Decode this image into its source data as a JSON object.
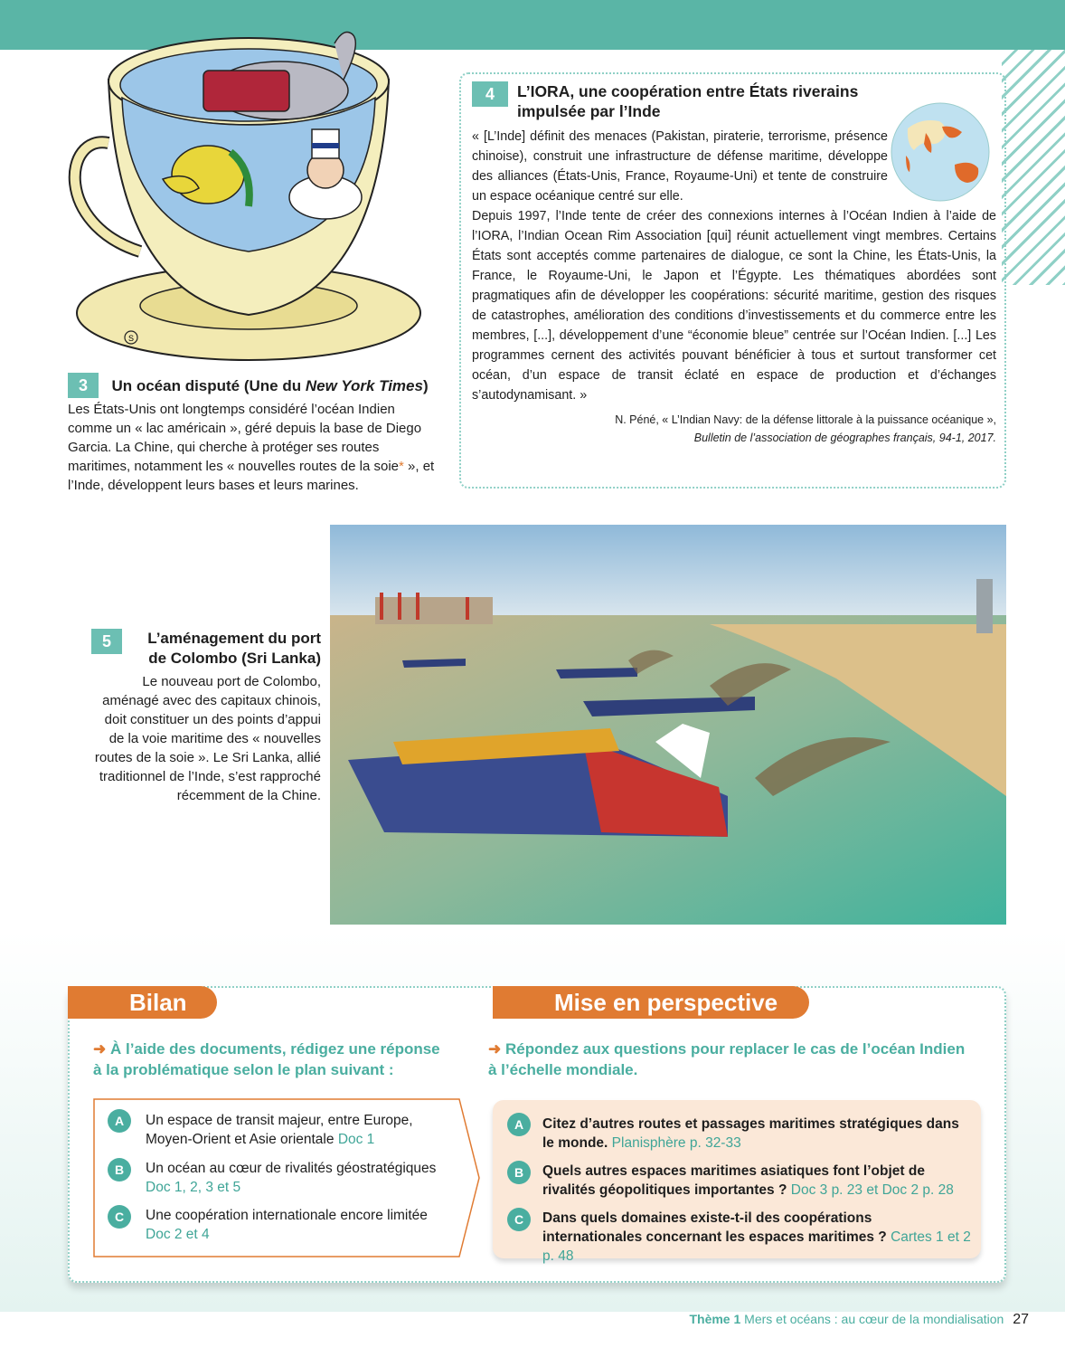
{
  "doc3": {
    "number": "3",
    "title_main": "Un océan disputé (Une du ",
    "title_italic": "New York Times",
    "title_end": ")",
    "caption_start": "Les États-Unis ont longtemps considéré l’océan Indien comme un « lac américain », géré depuis la base de Diego Garcia. La Chine, qui cherche à protéger ses routes maritimes, notamment les « nouvelles routes de la soie",
    "asterisk": "*",
    "caption_end": " », et l’Inde, développent leurs bases et leurs marines."
  },
  "doc4": {
    "number": "4",
    "title": "L’IORA, une coopération entre États riverains impulsée par l’Inde",
    "quote_p1": "« [L’Inde] définit des menaces (Pakistan, piraterie, terrorisme, présence chinoise), construit une infrastructure de défense maritime, développe des alliances (États-Unis, France, Royaume-Uni) et tente de construire un espace océanique centré sur elle.",
    "quote_p2": "Depuis 1997, l’Inde tente de créer des connexions internes à l’Océan Indien à l’aide de l’IORA, l’Indian Ocean Rim Association [qui] réunit actuellement vingt membres. Certains États sont acceptés comme partenaires de dialogue, ce sont la Chine, les États-Unis, la France, le Royaume-Uni, le Japon et l’Égypte. Les thématiques abordées sont pragmatiques afin de développer les coopérations: sécurité maritime, gestion des risques de catastrophes, amélioration des conditions d’investissements et du commerce entre les membres, [...], développement d’une “économie bleue” centrée sur l’Océan Indien. [...] Les programmes cernent des activités pouvant bénéficier à tous et surtout transformer cet océan, d’un espace de transit éclaté en espace de production et d’échanges s’autodynamisant. »",
    "source_line1": "N. Péné, « L’Indian Navy: de la défense littorale à la puissance océanique »,",
    "source_line2": "Bulletin de l’association de géographes français, 94-1, 2017."
  },
  "doc5": {
    "number": "5",
    "title": "L’aménagement du port de Colombo (Sri Lanka)",
    "caption": "Le nouveau port de Colombo, aménagé avec des capitaux chinois, doit constituer un des points d’appui de la voie maritime des « nouvelles routes de la soie ». Le Sri Lanka, allié traditionnel de l’Inde, s’est rapproché récemment de la Chine."
  },
  "bilan": {
    "tab": "Bilan",
    "arrow": "➜",
    "instruction": "À l’aide des documents, rédigez une réponse à la problématique selon le plan suivant :",
    "items": [
      {
        "letter": "A",
        "text": "Un espace de transit majeur, entre Europe, Moyen-Orient et Asie orientale",
        "ref": "Doc 1"
      },
      {
        "letter": "B",
        "text": "Un océan au cœur de rivalités géostratégiques",
        "ref": "Doc 1, 2, 3 et 5"
      },
      {
        "letter": "C",
        "text": "Une coopération internationale encore limitée",
        "ref": "Doc 2 et 4"
      }
    ]
  },
  "perspective": {
    "tab": "Mise en perspective",
    "arrow": "➜",
    "instruction": "Répondez aux questions pour replacer le cas de l’océan Indien à l’échelle mondiale.",
    "items": [
      {
        "letter": "A",
        "text": "Citez d’autres routes et passages maritimes stratégiques dans le monde.",
        "ref": "Planisphère p. 32-33"
      },
      {
        "letter": "B",
        "text": "Quels autres espaces maritimes asiatiques font l’objet de rivalités géopolitiques importantes ?",
        "ref": "Doc 3 p. 23 et Doc 2 p. 28"
      },
      {
        "letter": "C",
        "text": "Dans quels domaines existe-t-il des coopérations internationales concernant les espaces maritimes ?",
        "ref": "Cartes 1 et 2 p. 48"
      }
    ]
  },
  "footer": {
    "theme": "Thème 1",
    "subtitle": "Mers et océans : au cœur de la mondialisation",
    "page": "27"
  },
  "cartoon_signature": "S",
  "colors": {
    "teal": "#5ab5a6",
    "orange": "#e07b32",
    "accent_text": "#4aaea0"
  }
}
